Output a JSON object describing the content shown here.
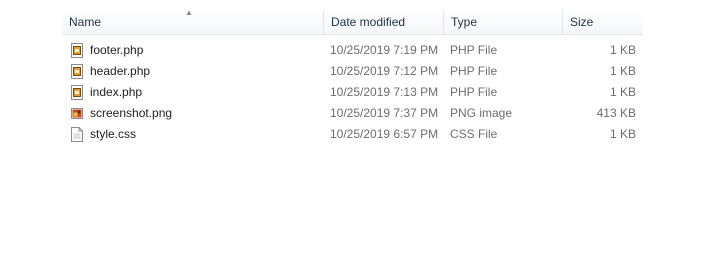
{
  "columns": {
    "name": "Name",
    "date": "Date modified",
    "type": "Type",
    "size": "Size"
  },
  "sort_arrow": "▲",
  "files": [
    {
      "name": "footer.php",
      "date": "10/25/2019 7:19 PM",
      "type": "PHP File",
      "size": "1 KB",
      "icon": "php-file-icon"
    },
    {
      "name": "header.php",
      "date": "10/25/2019 7:12 PM",
      "type": "PHP File",
      "size": "1 KB",
      "icon": "php-file-icon"
    },
    {
      "name": "index.php",
      "date": "10/25/2019 7:13 PM",
      "type": "PHP File",
      "size": "1 KB",
      "icon": "php-file-icon"
    },
    {
      "name": "screenshot.png",
      "date": "10/25/2019 7:37 PM",
      "type": "PNG image",
      "size": "413 KB",
      "icon": "image-file-icon"
    },
    {
      "name": "style.css",
      "date": "10/25/2019 6:57 PM",
      "type": "CSS File",
      "size": "1 KB",
      "icon": "text-file-icon"
    }
  ]
}
